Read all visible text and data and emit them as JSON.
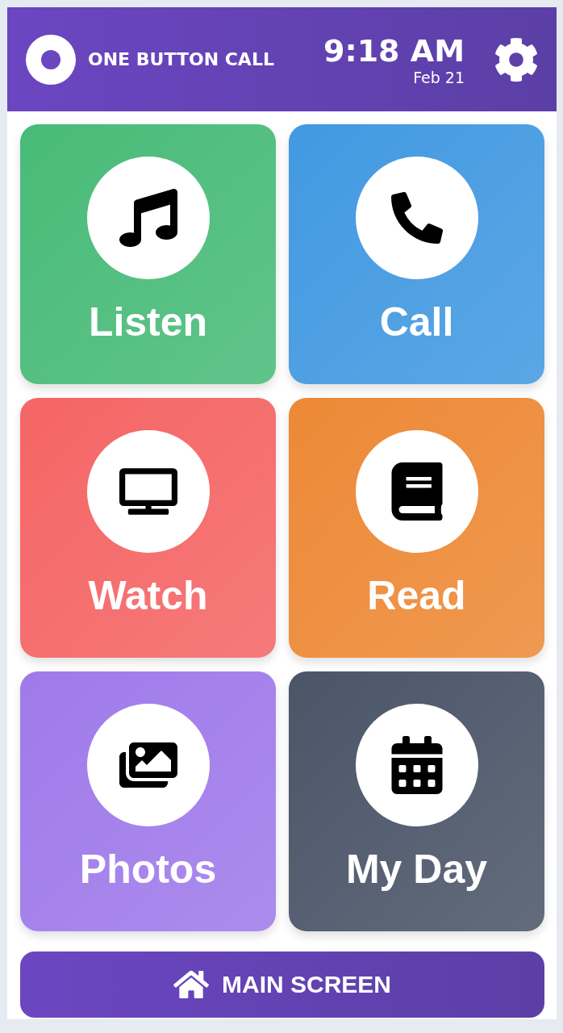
{
  "header": {
    "app_name": "ONE BUTTON CALL",
    "time": "9:18 AM",
    "date": "Feb 21"
  },
  "tiles": [
    {
      "label": "Listen",
      "color": "#48bb78"
    },
    {
      "label": "Call",
      "color": "#4299e1"
    },
    {
      "label": "Watch",
      "color": "#f56565"
    },
    {
      "label": "Read",
      "color": "#ed8936"
    },
    {
      "label": "Photos",
      "color": "#9f7aea"
    },
    {
      "label": "My Day",
      "color": "#4a5568"
    }
  ],
  "main_button": {
    "label": "MAIN SCREEN"
  }
}
